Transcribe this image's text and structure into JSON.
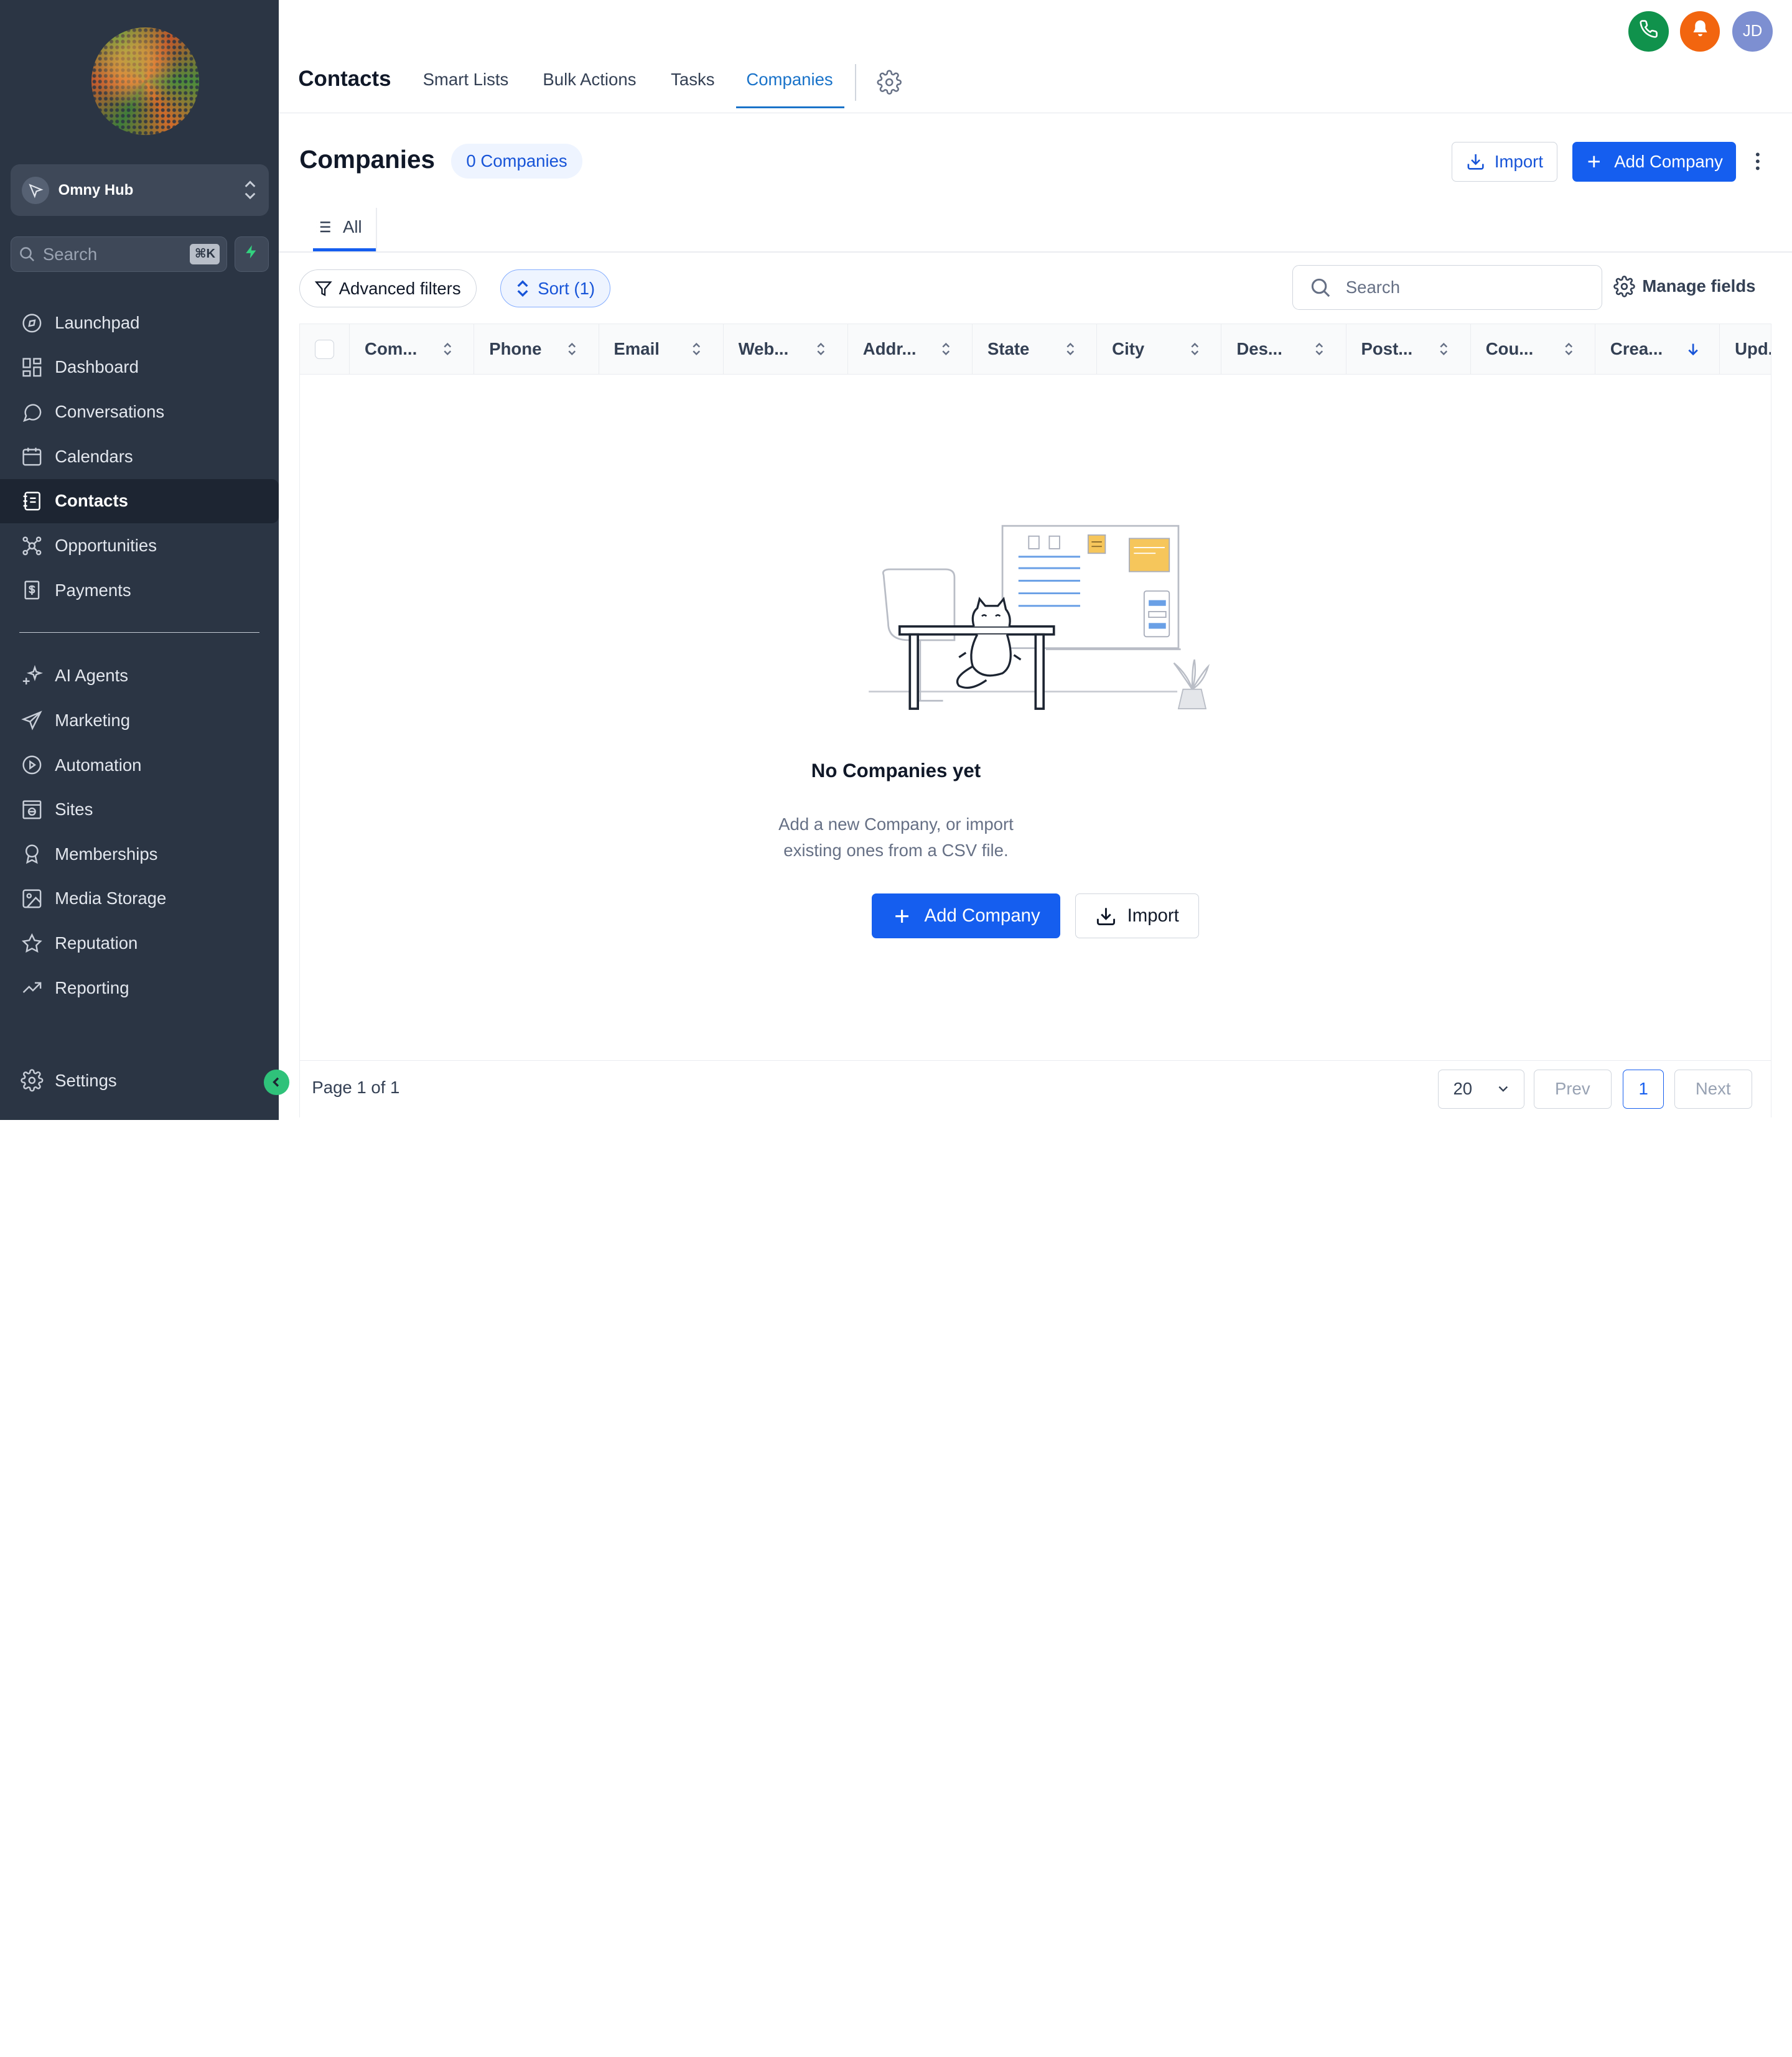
{
  "sidebar": {
    "account_name": "Omny Hub",
    "search_placeholder": "Search",
    "search_shortcut": "⌘K",
    "items": [
      {
        "label": "Launchpad",
        "icon": "launchpad-icon"
      },
      {
        "label": "Dashboard",
        "icon": "dashboard-icon"
      },
      {
        "label": "Conversations",
        "icon": "chat-icon"
      },
      {
        "label": "Calendars",
        "icon": "calendar-icon"
      },
      {
        "label": "Contacts",
        "icon": "contacts-icon",
        "active": true
      },
      {
        "label": "Opportunities",
        "icon": "opportunities-icon"
      },
      {
        "label": "Payments",
        "icon": "payments-icon"
      }
    ],
    "items2": [
      {
        "label": "AI Agents",
        "icon": "sparkle-icon"
      },
      {
        "label": "Marketing",
        "icon": "send-icon"
      },
      {
        "label": "Automation",
        "icon": "automation-icon"
      },
      {
        "label": "Sites",
        "icon": "sites-icon"
      },
      {
        "label": "Memberships",
        "icon": "badge-icon"
      },
      {
        "label": "Media Storage",
        "icon": "image-icon"
      },
      {
        "label": "Reputation",
        "icon": "star-icon"
      },
      {
        "label": "Reporting",
        "icon": "trend-icon"
      }
    ],
    "settings_label": "Settings"
  },
  "topbar": {
    "title": "Contacts",
    "tabs": [
      "Smart Lists",
      "Bulk Actions",
      "Tasks",
      "Companies"
    ],
    "active_tab": "Companies",
    "avatar_initials": "JD",
    "colors": {
      "phone": "#10924c",
      "bell": "#f2650f",
      "avatar": "#7d8fd1"
    }
  },
  "page": {
    "title": "Companies",
    "count_label": "0 Companies",
    "import_label": "Import",
    "add_label": "Add Company",
    "view_tab": "All",
    "advanced_filters_label": "Advanced filters",
    "sort_label": "Sort (1)",
    "search_placeholder": "Search",
    "manage_fields_label": "Manage fields"
  },
  "table": {
    "columns": [
      "Com...",
      "Phone",
      "Email",
      "Web...",
      "Addr...",
      "State",
      "City",
      "Des...",
      "Post...",
      "Cou...",
      "Crea...",
      "Upd..."
    ],
    "sorted_column": "Crea...",
    "rows": []
  },
  "empty_state": {
    "title": "No Companies yet",
    "desc_line1": "Add a new Company, or import",
    "desc_line2": "existing ones from a CSV file.",
    "add_label": "Add Company",
    "import_label": "Import"
  },
  "pagination": {
    "page_info": "Page 1 of 1",
    "per_page": "20",
    "prev_label": "Prev",
    "current_page": "1",
    "next_label": "Next"
  },
  "colors": {
    "accent": "#155eef",
    "sidebar_bg": "#2b3544"
  }
}
